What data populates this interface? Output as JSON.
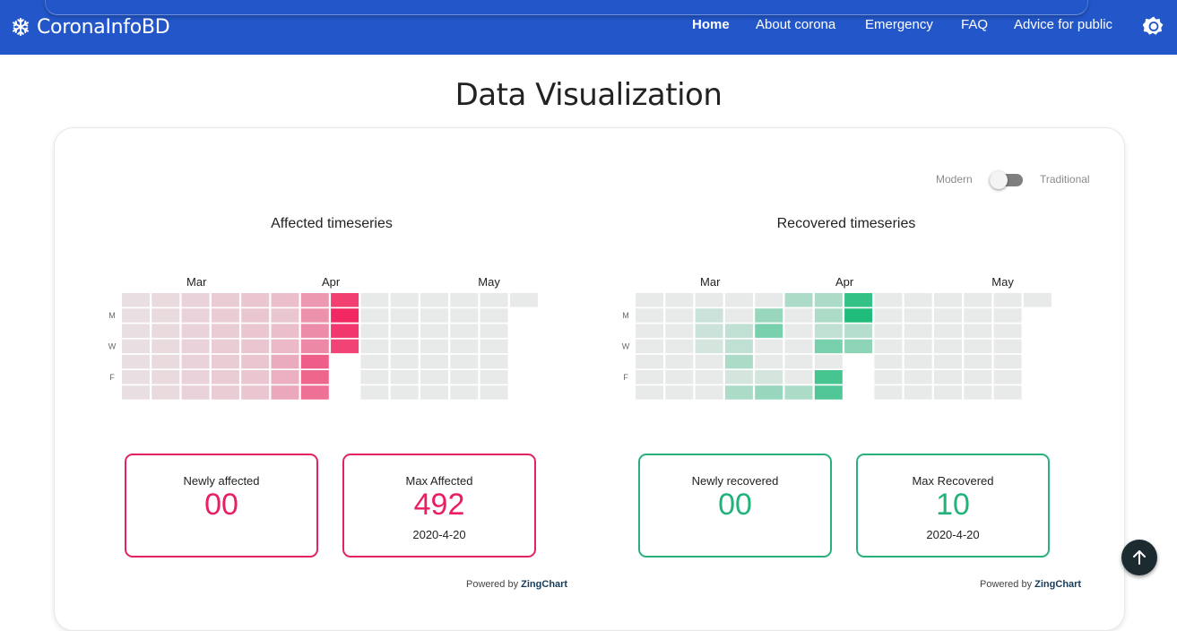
{
  "navbar": {
    "brand": "CoronaInfoBD",
    "brand_icon": "snowflake-icon",
    "links": [
      {
        "label": "Home",
        "active": true
      },
      {
        "label": "About corona",
        "active": false
      },
      {
        "label": "Emergency",
        "active": false
      },
      {
        "label": "FAQ",
        "active": false
      },
      {
        "label": "Advice for public",
        "active": false
      }
    ],
    "theme_icon": "brightness-icon",
    "color": "#2256c9"
  },
  "page_title": "Data Visualization",
  "view_toggle": {
    "left_label": "Modern",
    "right_label": "Traditional",
    "state": "Modern"
  },
  "chart_data": [
    {
      "type": "heatmap",
      "title": "Affected timeseries",
      "month_labels": [
        "Mar",
        "Apr",
        "May"
      ],
      "day_labels": [
        "M",
        "W",
        "F"
      ],
      "color": "#f22862",
      "levels": [
        [
          0.05,
          0.05,
          0.05,
          0.05,
          0.05,
          0.05,
          0.05
        ],
        [
          0.08,
          0.08,
          0.08,
          0.08,
          0.08,
          0.08,
          0.08
        ],
        [
          0.12,
          0.12,
          0.12,
          0.12,
          0.12,
          0.12,
          0.12
        ],
        [
          0.15,
          0.15,
          0.15,
          0.15,
          0.15,
          0.15,
          0.15
        ],
        [
          0.18,
          0.18,
          0.18,
          0.18,
          0.18,
          0.18,
          0.18
        ],
        [
          0.22,
          0.18,
          0.22,
          0.25,
          0.32,
          0.3,
          0.34
        ],
        [
          0.42,
          0.45,
          0.48,
          0.5,
          0.72,
          0.68,
          0.62
        ],
        [
          0.88,
          1.0,
          0.92,
          0.86,
          null,
          null,
          null
        ],
        [
          0,
          0,
          0,
          0,
          0,
          0,
          0
        ],
        [
          0,
          0,
          0,
          0,
          0,
          0,
          0
        ],
        [
          0,
          0,
          0,
          0,
          0,
          0,
          0
        ],
        [
          0,
          0,
          0,
          0,
          0,
          0,
          0
        ],
        [
          0,
          0,
          0,
          0,
          0,
          0,
          0
        ],
        [
          0,
          null,
          null,
          null,
          null,
          null,
          null
        ]
      ],
      "stats": [
        {
          "label": "Newly affected",
          "value": "00",
          "date": ""
        },
        {
          "label": "Max Affected",
          "value": "492",
          "date": "2020-4-20"
        }
      ],
      "powered_prefix": "Powered by",
      "powered_brand": "ZingChart"
    },
    {
      "type": "heatmap",
      "title": "Recovered timeseries",
      "month_labels": [
        "Mar",
        "Apr",
        "May"
      ],
      "day_labels": [
        "M",
        "W",
        "F"
      ],
      "color": "#1fbc7b",
      "levels": [
        [
          0,
          0,
          0,
          0,
          0,
          0,
          0
        ],
        [
          0,
          0,
          0,
          0,
          0,
          0,
          0
        ],
        [
          0,
          0.15,
          0.15,
          0.1,
          0,
          0,
          0
        ],
        [
          0,
          0,
          0.2,
          0.2,
          0.3,
          0.1,
          0.3
        ],
        [
          0,
          0.4,
          0.55,
          0,
          0,
          0.1,
          0.4
        ],
        [
          0.3,
          0,
          0,
          0,
          0,
          0,
          0.3
        ],
        [
          0.3,
          0.3,
          0.2,
          0.55,
          0,
          0.8,
          0.75
        ],
        [
          0.9,
          1.0,
          0.25,
          0.45,
          null,
          null,
          null
        ],
        [
          0,
          0,
          0,
          0,
          0,
          0,
          0
        ],
        [
          0,
          0,
          0,
          0,
          0,
          0,
          0
        ],
        [
          0,
          0,
          0,
          0,
          0,
          0,
          0
        ],
        [
          0,
          0,
          0,
          0,
          0,
          0,
          0
        ],
        [
          0,
          0,
          0,
          0,
          0,
          0,
          0
        ],
        [
          0,
          null,
          null,
          null,
          null,
          null,
          null
        ]
      ],
      "stats": [
        {
          "label": "Newly recovered",
          "value": "00",
          "date": ""
        },
        {
          "label": "Max Recovered",
          "value": "10",
          "date": "2020-4-20"
        }
      ],
      "powered_prefix": "Powered by",
      "powered_brand": "ZingChart"
    }
  ]
}
